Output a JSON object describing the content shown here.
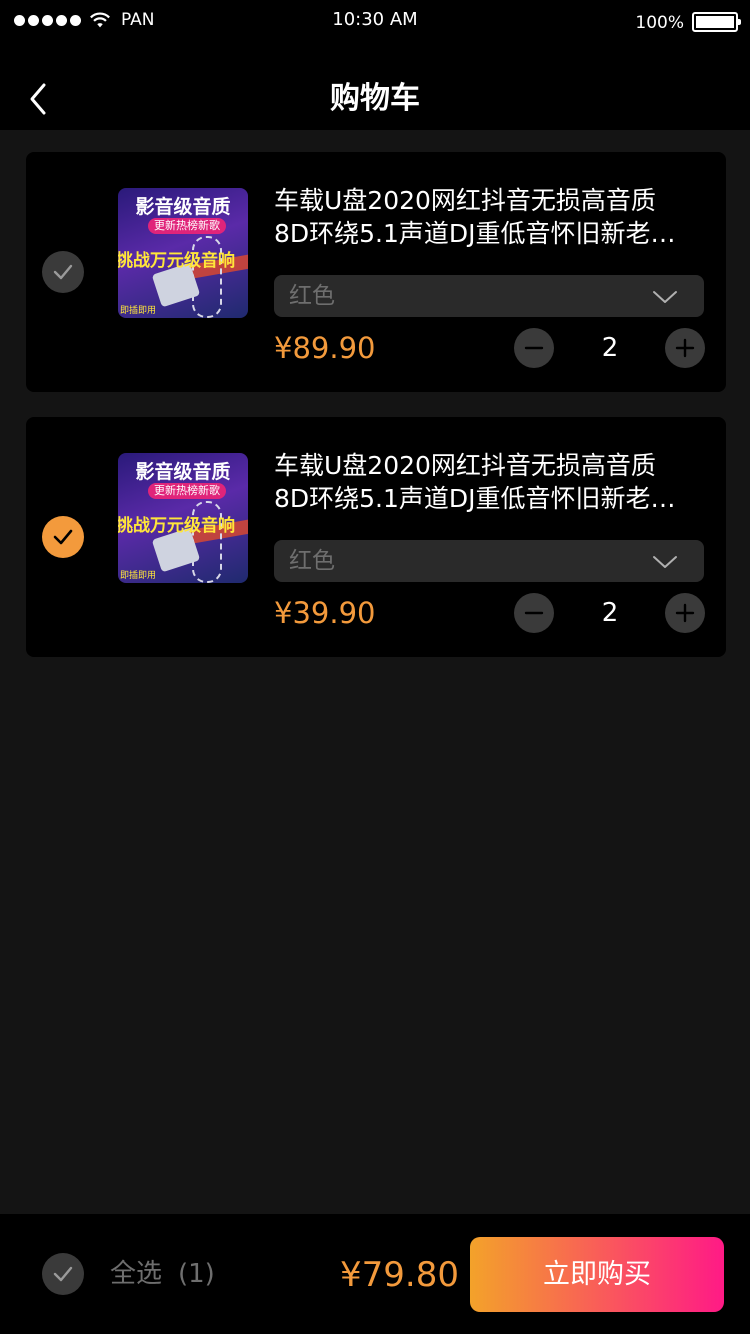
{
  "status_bar": {
    "carrier": "PAN",
    "time": "10:30 AM",
    "battery": "100%"
  },
  "nav": {
    "title": "购物车",
    "back_icon": "chevron-left-icon"
  },
  "cart_items": [
    {
      "checked": false,
      "thumb": {
        "line1": "影音级音质",
        "badge": "更新热榜新歌",
        "line3": "挑战万元级音响",
        "footnote": "即插即用"
      },
      "name_line1": "车载U盘2020网红抖音无损高音质",
      "name_line2": "8D环绕5.1声道DJ重低音怀旧新老…",
      "spec": "红色",
      "price": "¥89.90",
      "quantity": "2"
    },
    {
      "checked": true,
      "thumb": {
        "line1": "影音级音质",
        "badge": "更新热榜新歌",
        "line3": "挑战万元级音响",
        "footnote": "即插即用"
      },
      "name_line1": "车载U盘2020网红抖音无损高音质",
      "name_line2": "8D环绕5.1声道DJ重低音怀旧新老…",
      "spec": "红色",
      "price": "¥39.90",
      "quantity": "2"
    }
  ],
  "footer": {
    "select_all_label": "全选",
    "select_all_count": "(1)",
    "total": "¥79.80",
    "buy_label": "立即购买"
  },
  "colors": {
    "accent": "#f39a3c",
    "buy_gradient_start": "#f3a22a",
    "buy_gradient_end": "#ff1a86",
    "card_bg": "#000000",
    "page_bg": "#141414"
  }
}
